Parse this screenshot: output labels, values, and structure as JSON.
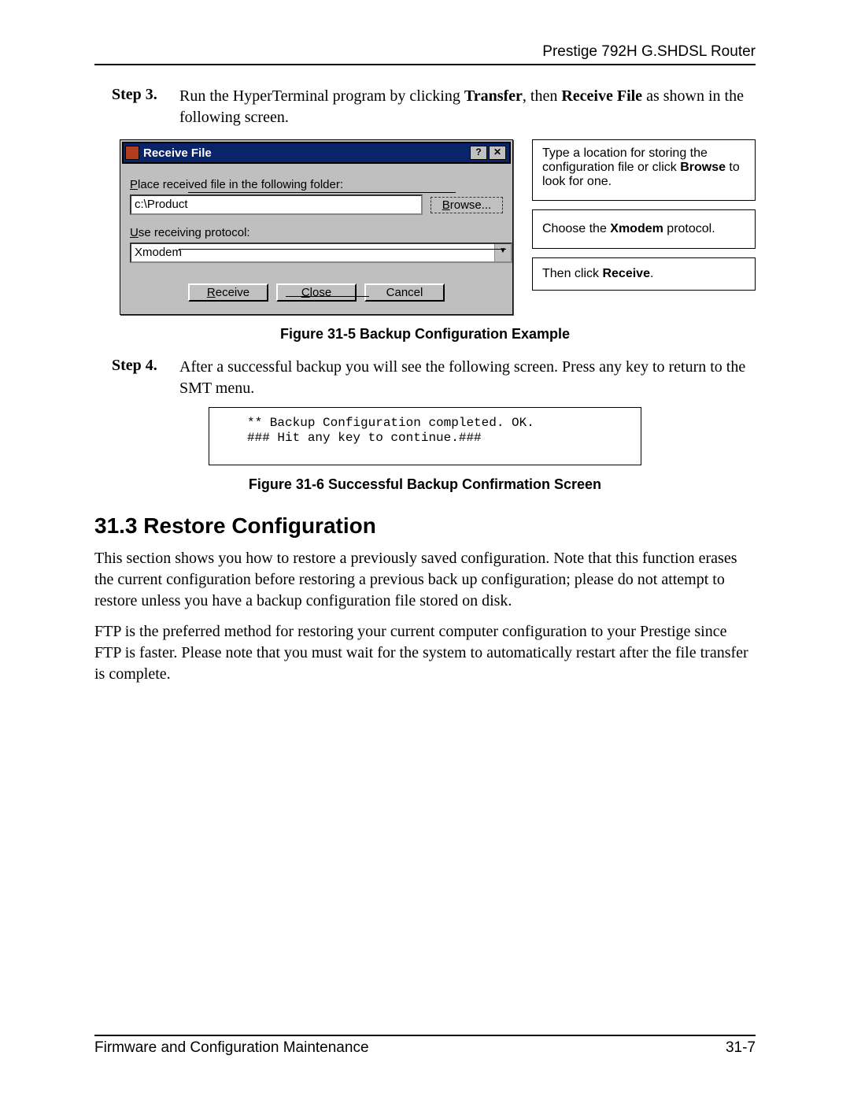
{
  "header": {
    "product": "Prestige 792H G.SHDSL Router"
  },
  "step3": {
    "label": "Step 3.",
    "pre": "Run the HyperTerminal program by clicking ",
    "bold1": "Transfer",
    "mid": ", then ",
    "bold2": "Receive File",
    "post": " as shown in the following screen."
  },
  "dialog": {
    "title": "Receive File",
    "help": "?",
    "close": "✕",
    "label_place_pre": "P",
    "label_place_rest": "lace received file in the following folder:",
    "path": "c:\\Product",
    "browse_mn": "B",
    "browse_rest": "rowse...",
    "label_use_pre": "U",
    "label_use_rest": "se receiving protocol:",
    "protocol": "Xmodem",
    "receive_mn": "R",
    "receive_rest": "eceive",
    "close_mn": "C",
    "close_rest": "lose",
    "cancel": "Cancel"
  },
  "callouts": {
    "c1_pre": "Type a location for storing the configuration file or click ",
    "c1_bold": "Browse",
    "c1_post": " to look for one.",
    "c2_pre": "Choose the ",
    "c2_bold": "Xmodem",
    "c2_post": " protocol.",
    "c3_pre": "Then click ",
    "c3_bold": "Receive",
    "c3_post": "."
  },
  "fig5_caption": "Figure 31-5 Backup Configuration Example",
  "step4": {
    "label": "Step 4.",
    "text": "After a successful backup you will see the following screen. Press any key to return to the SMT menu."
  },
  "code": {
    "l1": "** Backup Configuration completed. OK.",
    "l2": "### Hit any key to continue.###"
  },
  "fig6_caption": "Figure 31-6 Successful Backup Confirmation Screen",
  "section": {
    "heading": "31.3  Restore Configuration",
    "p1": "This section shows you how to restore a previously saved configuration. Note that this function erases the current configuration before restoring a previous back up configuration; please do not attempt to restore unless you have a backup configuration file stored on disk.",
    "p2": "FTP is the preferred method for restoring your current computer configuration to your Prestige since FTP is faster.  Please note that you must wait for the system to automatically restart after the file transfer is complete."
  },
  "footer": {
    "left": "Firmware and Configuration Maintenance",
    "right": "31-7"
  }
}
